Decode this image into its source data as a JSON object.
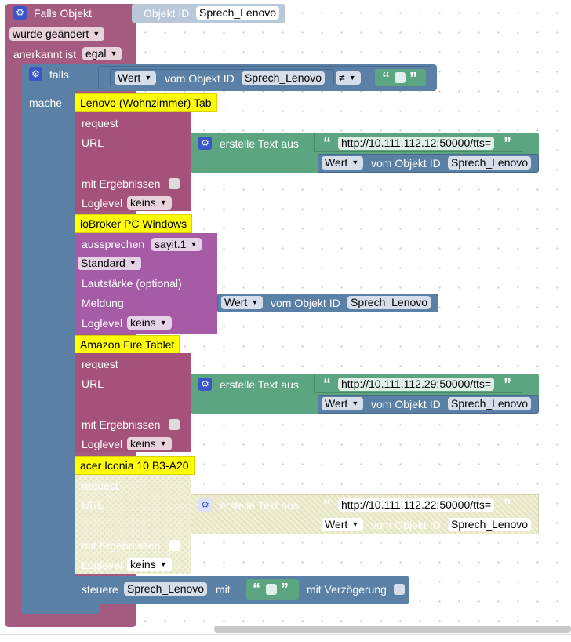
{
  "trigger": {
    "title": "Falls Objekt",
    "object_id_label": "Objekt ID",
    "object_id": "Sprech_Lenovo",
    "changed": "wurde geändert",
    "ack_label": "anerkannt ist",
    "ack_value": "egal"
  },
  "if_block": {
    "falls": "falls",
    "mache": "mache",
    "value": "Wert",
    "vom_objekt_id": "vom Objekt ID",
    "object_id": "Sprech_Lenovo",
    "operator": "≠"
  },
  "comments": {
    "lenovo": "Lenovo (Wohnzimmer) Tab",
    "iobroker": "ioBroker PC Windows",
    "amazon": "Amazon Fire Tablet",
    "acer": "acer Iconia 10 B3-A20"
  },
  "request1": {
    "request": "request",
    "url": "URL",
    "create_text": "erstelle Text aus",
    "url_text": "http://10.111.112.12:50000/tts=",
    "value": "Wert",
    "vom_objekt_id": "vom Objekt ID",
    "object_id": "Sprech_Lenovo",
    "with_results": "mit Ergebnissen",
    "loglevel": "Loglevel",
    "loglevel_value": "keins"
  },
  "say": {
    "speak": "aussprechen",
    "instance": "sayit.1",
    "language": "Standard",
    "volume": "Lautstärke (optional)",
    "message": "Meldung",
    "value": "Wert",
    "vom_objekt_id": "vom Objekt ID",
    "object_id": "Sprech_Lenovo",
    "loglevel": "Loglevel",
    "loglevel_value": "keins"
  },
  "request2": {
    "request": "request",
    "url": "URL",
    "create_text": "erstelle Text aus",
    "url_text": "http://10.111.112.29:50000/tts=",
    "value": "Wert",
    "vom_objekt_id": "vom Objekt ID",
    "object_id": "Sprech_Lenovo",
    "with_results": "mit Ergebnissen",
    "loglevel": "Loglevel",
    "loglevel_value": "keins"
  },
  "request3": {
    "request": "request",
    "url": "URL",
    "create_text": "erstelle Text aus",
    "url_text": "http://10.111.112.22:50000/tts=",
    "value": "Wert",
    "vom_objekt_id": "vom Objekt ID",
    "object_id": "Sprech_Lenovo",
    "with_results": "mit Ergebnissen",
    "loglevel": "Loglevel",
    "loglevel_value": "keins"
  },
  "control": {
    "steuere": "steuere",
    "object_id": "Sprech_Lenovo",
    "mit": "mit",
    "delay": "mit Verzögerung"
  },
  "icons": {
    "gear": "gear-icon",
    "quote_open": "“",
    "quote_close": "”",
    "dropdown": "▼"
  },
  "colors": {
    "trigger": "#a55b80",
    "logic": "#5b80a5",
    "request": "#a5527a",
    "say": "#a55ba5",
    "text": "#5ba580",
    "comment": "#ffff00",
    "disabled": "#e6e6c4"
  }
}
